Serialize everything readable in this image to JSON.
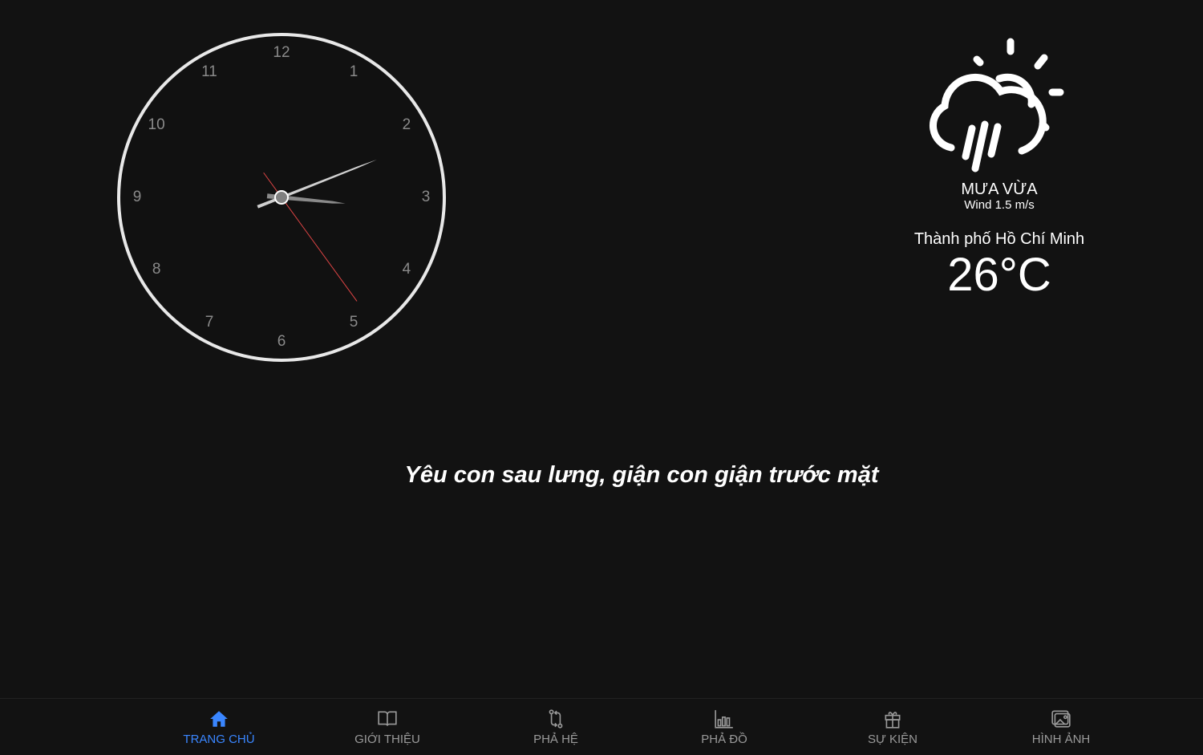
{
  "clock": {
    "numbers": [
      "12",
      "1",
      "2",
      "3",
      "4",
      "5",
      "6",
      "7",
      "8",
      "9",
      "10",
      "11"
    ],
    "time": {
      "hours": 3,
      "minutes": 11,
      "seconds": 24
    }
  },
  "weather": {
    "icon": "cloud-rain-sun-icon",
    "condition": "MƯA VỪA",
    "wind": "Wind 1.5 m/s",
    "city": "Thành phố Hồ Chí Minh",
    "temperature": "26°C"
  },
  "quote": "Yêu con sau lưng, giận con giận trước mặt",
  "nav": {
    "accent": "#3a86ff",
    "items": [
      {
        "label": "TRANG CHỦ",
        "icon": "home-icon",
        "active": true
      },
      {
        "label": "GIỚI THIỆU",
        "icon": "book-icon"
      },
      {
        "label": "PHẢ HỆ",
        "icon": "git-compare-icon"
      },
      {
        "label": "PHẢ ĐỒ",
        "icon": "bar-chart-icon"
      },
      {
        "label": "SỰ KIỆN",
        "icon": "gift-icon"
      },
      {
        "label": "HÌNH ẢNH",
        "icon": "images-icon"
      }
    ]
  }
}
